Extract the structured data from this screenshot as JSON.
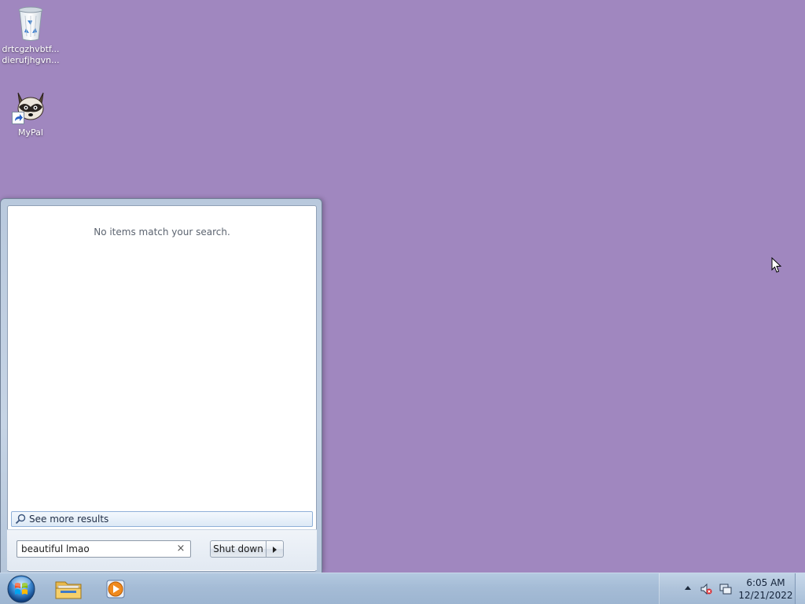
{
  "desktop": {
    "background_color": "#a087bf",
    "icons": [
      {
        "name": "recycle-bin",
        "label_line1": "drtcgzhvbtf...",
        "label_line2": "dierufjhgvn...",
        "icon": "recycle-bin-icon"
      },
      {
        "name": "mypal",
        "label": "MyPal",
        "icon": "raccoon-icon",
        "shortcut": true
      }
    ]
  },
  "start_menu": {
    "no_results_text": "No items match your search.",
    "see_more_label": "See more results",
    "search": {
      "value": "beautiful lmao",
      "clear_icon": "×"
    },
    "shutdown_label": "Shut down"
  },
  "taskbar": {
    "pinned": [
      {
        "name": "windows-explorer",
        "icon": "folder-icon"
      },
      {
        "name": "windows-media-player",
        "icon": "media-player-icon"
      }
    ],
    "tray": {
      "volume_icon": "volume-muted-icon",
      "network_icon": "network-icon",
      "time": "6:05 AM",
      "date": "12/21/2022"
    }
  }
}
